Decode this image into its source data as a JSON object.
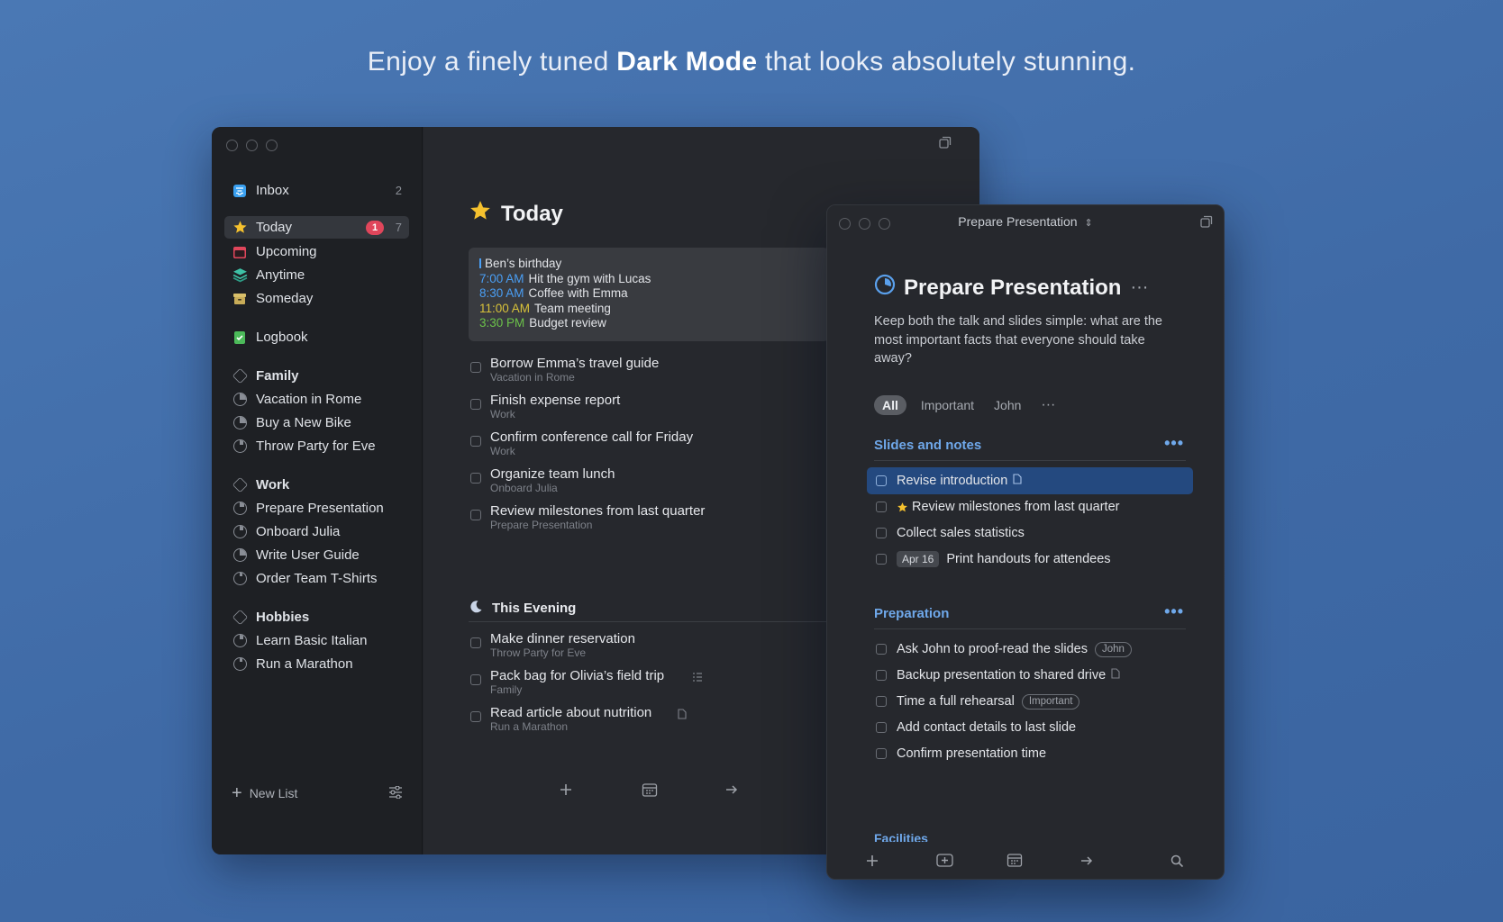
{
  "headline": {
    "pre": "Enjoy a finely tuned ",
    "bold": "Dark Mode",
    "post": " that looks absolutely stunning."
  },
  "sidebar": {
    "inbox": {
      "label": "Inbox",
      "count": "2"
    },
    "today": {
      "label": "Today",
      "badge": "1",
      "count": "7"
    },
    "upcoming": {
      "label": "Upcoming"
    },
    "anytime": {
      "label": "Anytime"
    },
    "someday": {
      "label": "Someday"
    },
    "logbook": {
      "label": "Logbook"
    },
    "areas": [
      {
        "label": "Family",
        "projects": [
          "Vacation in Rome",
          "Buy a New Bike",
          "Throw Party for Eve"
        ]
      },
      {
        "label": "Work",
        "projects": [
          "Prepare Presentation",
          "Onboard Julia",
          "Write User Guide",
          "Order Team T-Shirts"
        ]
      },
      {
        "label": "Hobbies",
        "projects": [
          "Learn Basic Italian",
          "Run a Marathon"
        ]
      }
    ],
    "new_list": "New List"
  },
  "today": {
    "title": "Today",
    "events": [
      {
        "time": "",
        "text": "Ben’s birthday",
        "color": "#4a9ff5"
      },
      {
        "time": "7:00 AM",
        "text": "Hit the gym with Lucas",
        "color": "#4a9ff5"
      },
      {
        "time": "8:30 AM",
        "text": "Coffee with Emma",
        "color": "#4a9ff5"
      },
      {
        "time": "11:00 AM",
        "text": "Team meeting",
        "color": "#d8c23a"
      },
      {
        "time": "3:30 PM",
        "text": "Budget review",
        "color": "#6cc24a"
      }
    ],
    "tasks": [
      {
        "title": "Borrow Emma’s travel guide",
        "sub": "Vacation in Rome"
      },
      {
        "title": "Finish expense report",
        "sub": "Work"
      },
      {
        "title": "Confirm conference call for Friday",
        "sub": "Work"
      },
      {
        "title": "Organize team lunch",
        "sub": "Onboard Julia"
      },
      {
        "title": "Review milestones from last quarter",
        "sub": "Prepare Presentation"
      }
    ],
    "evening_title": "This Evening",
    "evening_tasks": [
      {
        "title": "Make dinner reservation",
        "sub": "Throw Party for Eve"
      },
      {
        "title": "Pack bag for Olivia’s field trip",
        "sub": "Family"
      },
      {
        "title": "Read article about nutrition",
        "sub": "Run a Marathon"
      }
    ]
  },
  "detail": {
    "window_title": "Prepare Presentation",
    "heading": "Prepare Presentation",
    "notes": "Keep both the talk and slides simple: what are the most important facts that everyone should take away?",
    "filters": {
      "all": "All",
      "important": "Important",
      "john": "John"
    },
    "sections": [
      {
        "title": "Slides and notes",
        "tasks": [
          {
            "title": "Revise introduction"
          },
          {
            "title": "Review milestones from last quarter"
          },
          {
            "title": "Collect sales statistics"
          },
          {
            "title": "Print handouts for attendees",
            "date": "Apr 16"
          }
        ]
      },
      {
        "title": "Preparation",
        "tasks": [
          {
            "title": "Ask John to proof-read the slides",
            "tag": "John"
          },
          {
            "title": "Backup presentation to shared drive"
          },
          {
            "title": "Time a full rehearsal",
            "tag": "Important"
          },
          {
            "title": "Add contact details to last slide"
          },
          {
            "title": "Confirm presentation time"
          }
        ]
      }
    ],
    "next_section": "Facilities"
  },
  "colors": {
    "accent": "#6fa8ea",
    "selection": "#24497f",
    "badge": "#e0465b",
    "star": "#f5c12e"
  }
}
